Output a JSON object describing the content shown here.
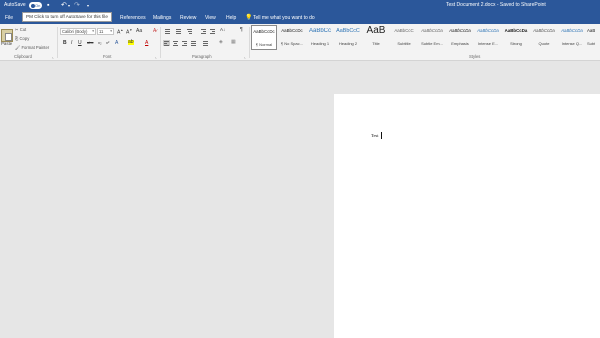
{
  "titlebar": {
    "autosave_label": "AutoSave",
    "autosave_state": "On",
    "doc_title": "Test Document 2.docx  -  Saved to SharePoint"
  },
  "tooltip": {
    "text": "PM Click to turn off AutoSave for this file"
  },
  "tabs": [
    {
      "label": "File"
    },
    {
      "label": "References"
    },
    {
      "label": "Mailings"
    },
    {
      "label": "Review"
    },
    {
      "label": "View"
    },
    {
      "label": "Help"
    }
  ],
  "tell_me": "Tell me what you want to do",
  "ribbon": {
    "clipboard": {
      "paste": "Paste",
      "cut": "Cut",
      "copy": "Copy",
      "format_painter": "Format Painter",
      "group": "Clipboard"
    },
    "font": {
      "name": "Calibri (Body)",
      "size": "11",
      "group": "Font"
    },
    "paragraph": {
      "group": "Paragraph"
    },
    "styles": {
      "group": "Styles",
      "items": [
        {
          "preview": "AaBbCcDc",
          "name": "¶ Normal"
        },
        {
          "preview": "AaBbCcDc",
          "name": "¶ No Spac..."
        },
        {
          "preview": "AaBbCc",
          "name": "Heading 1"
        },
        {
          "preview": "AaBbCcC",
          "name": "Heading 2"
        },
        {
          "preview": "AaB",
          "name": "Title"
        },
        {
          "preview": "AaBbCcC",
          "name": "Subtitle"
        },
        {
          "preview": "AaBbCcDa",
          "name": "Subtle Em..."
        },
        {
          "preview": "AaBbCcDa",
          "name": "Emphasis"
        },
        {
          "preview": "AaBbCcDa",
          "name": "Intense E..."
        },
        {
          "preview": "AaBbCcDa",
          "name": "Strong"
        },
        {
          "preview": "AaBbCcDa",
          "name": "Quote"
        },
        {
          "preview": "AaBbCcDa",
          "name": "Intense Q..."
        },
        {
          "preview": "AaBbCcDa",
          "name": "Subt..."
        }
      ]
    }
  },
  "document": {
    "text": "Test"
  },
  "colors": {
    "accent": "#2b579a",
    "ribbon": "#f3f3f3",
    "canvas": "#e6e6e6"
  }
}
